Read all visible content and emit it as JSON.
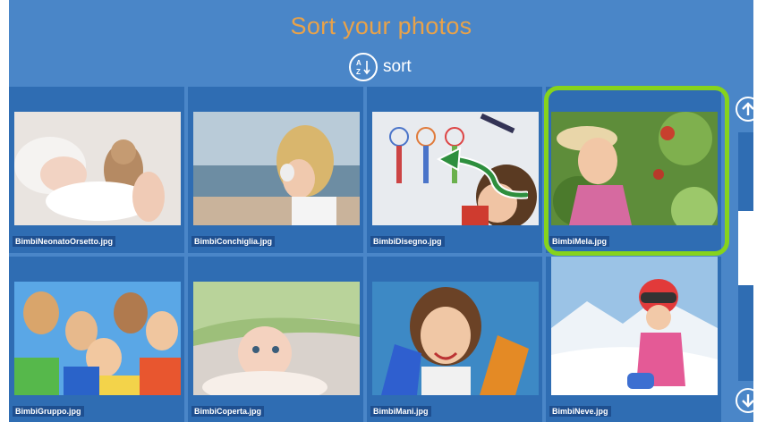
{
  "header": {
    "title": "Sort your photos",
    "sort_label": "sort"
  },
  "photos": [
    {
      "filename": "BimbiNeonatoOrsetto.jpg",
      "subject": "newborn-with-teddy"
    },
    {
      "filename": "BimbiConchiglia.jpg",
      "subject": "child-with-seashell"
    },
    {
      "filename": "BimbiDisegno.jpg",
      "subject": "child-drawing"
    },
    {
      "filename": "BimbiMela.jpg",
      "subject": "child-picking-apple"
    },
    {
      "filename": "BimbiGruppo.jpg",
      "subject": "group-of-children"
    },
    {
      "filename": "BimbiCoperta.jpg",
      "subject": "baby-under-blanket"
    },
    {
      "filename": "BimbiMani.jpg",
      "subject": "child-painted-hands"
    },
    {
      "filename": "BimbiNeve.jpg",
      "subject": "child-in-snow"
    }
  ],
  "selected_photo": "BimbiMela.jpg",
  "scrollbar": {
    "position": 0.45,
    "visible_fraction": 0.3
  },
  "colors": {
    "background": "#4a86c8",
    "tile": "#2f6db3",
    "title": "#e8a24a",
    "highlight": "#86d31c"
  },
  "icons": {
    "sort": "sort-az-icon",
    "scroll_up": "arrow-up-icon",
    "scroll_down": "arrow-down-icon"
  }
}
